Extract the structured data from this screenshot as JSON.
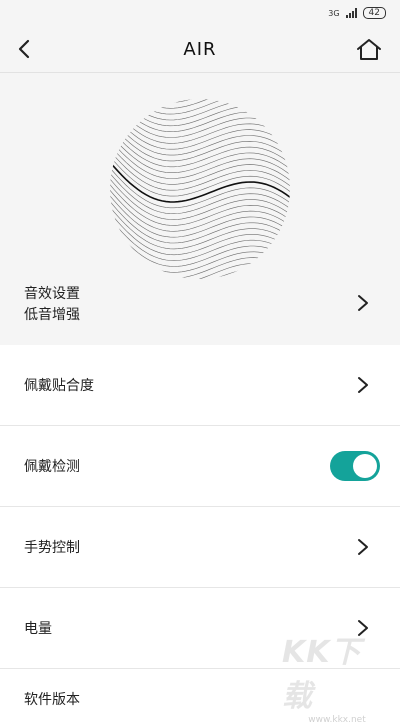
{
  "status_bar": {
    "network": "3G",
    "battery": "42"
  },
  "header": {
    "title": "AIR",
    "back_icon": "back-arrow-icon",
    "home_icon": "home-icon"
  },
  "hero": {
    "art_icon": "sound-wave-sphere",
    "setting_title": "音效设置",
    "setting_value": "低音增强"
  },
  "rows": [
    {
      "label": "佩戴贴合度",
      "control": "chevron"
    },
    {
      "label": "佩戴检测",
      "control": "toggle",
      "toggle_on": true
    },
    {
      "label": "手势控制",
      "control": "chevron"
    },
    {
      "label": "电量",
      "control": "chevron"
    },
    {
      "label": "软件版本",
      "control": "none"
    }
  ],
  "colors": {
    "accent": "#14a39a",
    "header_bg": "#f5f5f5"
  },
  "watermark": {
    "brand": "KK下载",
    "url": "www.kkx.net"
  }
}
